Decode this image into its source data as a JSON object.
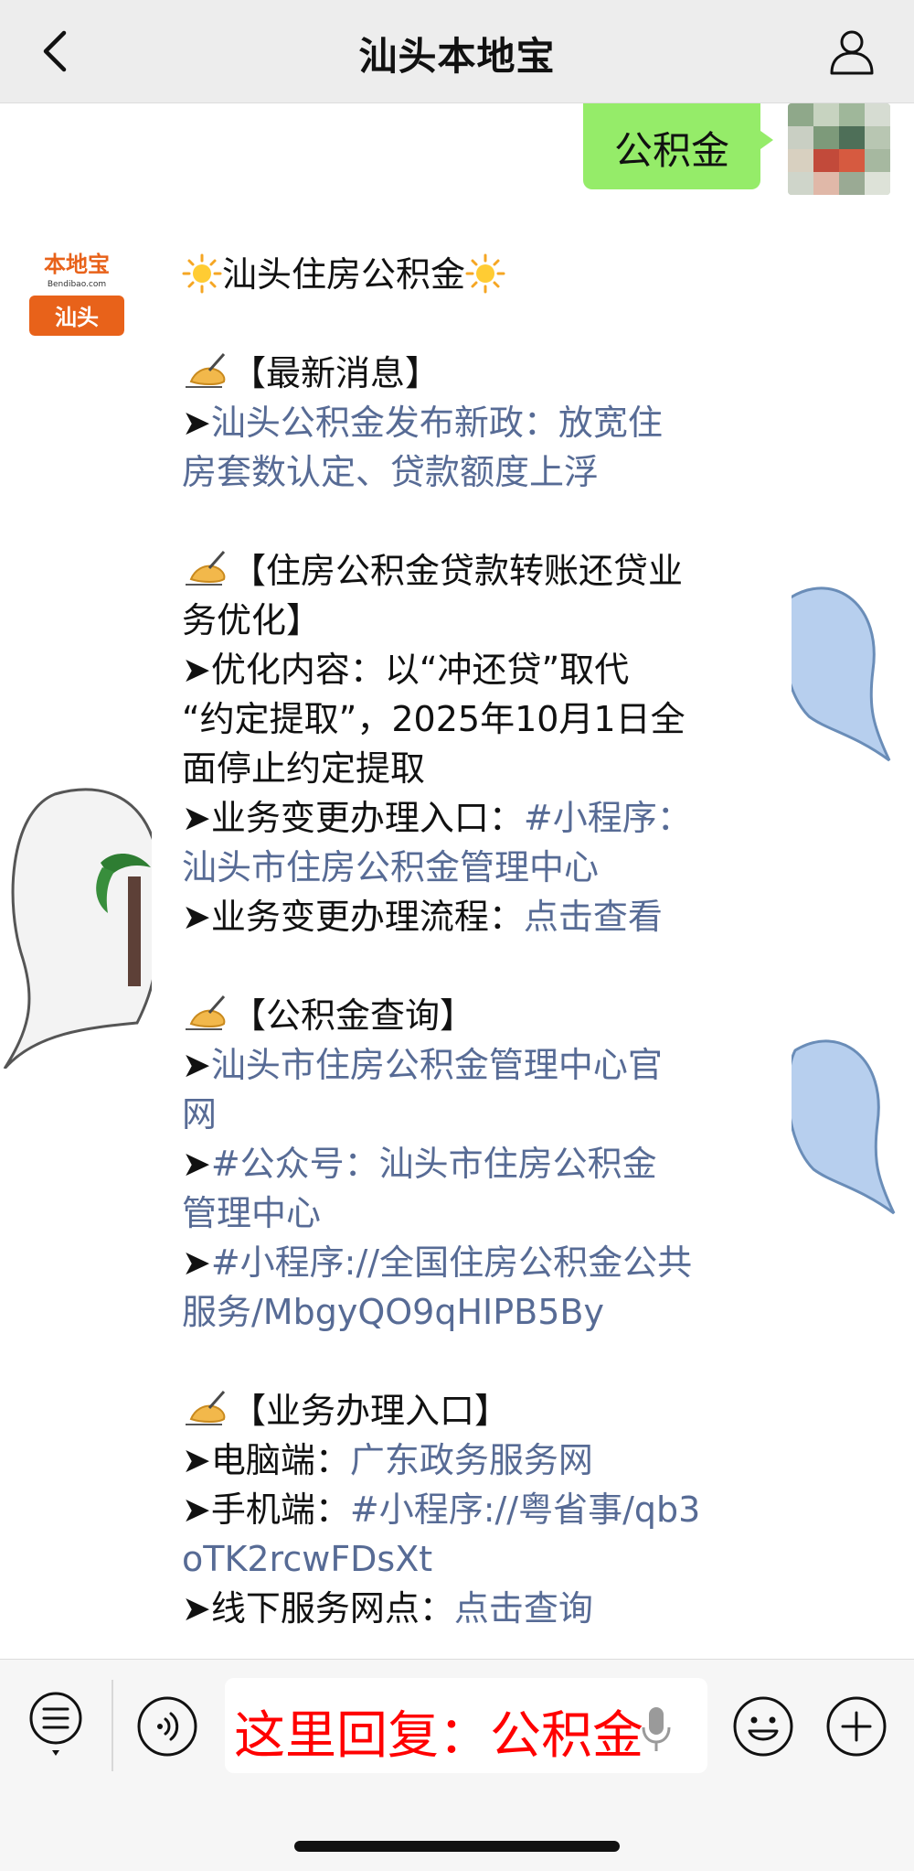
{
  "header": {
    "title": "汕头本地宝"
  },
  "chat": {
    "outgoing_text": "公积金",
    "bot_avatar": {
      "top_text": "本地宝",
      "sub_text": "Bendibao.com",
      "badge_text": "汕头"
    },
    "message": {
      "title": "汕头住房公积金",
      "s1_heading": "【最新消息】",
      "s1_item_link_l1": "汕头公积金发布新政：放宽住",
      "s1_item_link_l2": "房套数认定、贷款额度上浮",
      "s2_heading_l1": "【住房公积金贷款转账还贷业",
      "s2_heading_l2": "务优化】",
      "s2_item1_l1": "优化内容：以“冲还贷”取代",
      "s2_item1_l2": "“约定提取”，2025年10月1日全",
      "s2_item1_l3": "面停止约定提取",
      "s2_item2_label": "业务变更办理入口：",
      "s2_item2_link_l1": "#小程序：",
      "s2_item2_link_l2": "汕头市住房公积金管理中心",
      "s2_item3_label": "业务变更办理流程：",
      "s2_item3_link": "点击查看",
      "s3_heading": "【公积金查询】",
      "s3_item1_link_l1": "汕头市住房公积金管理中心官",
      "s3_item1_link_l2": "网",
      "s3_item2_link_l1": "#公众号：汕头市住房公积金",
      "s3_item2_link_l2": "管理中心",
      "s3_item3_link_l1": "#小程序://全国住房公积金公共",
      "s3_item3_link_l2": "服务/MbgyQO9qHIPB5By",
      "s4_heading": "【业务办理入口】",
      "s4_item1_label": "电脑端：",
      "s4_item1_link": "广东政务服务网",
      "s4_item2_label": "手机端：",
      "s4_item2_link_l1": "#小程序://粤省事/qb3",
      "s4_item2_link_l2": "oTK2rcwFDsXt",
      "s4_item3_label": "线下服务网点：",
      "s4_item3_link": "点击查询"
    }
  },
  "input": {
    "text": "这里回复：公积金"
  },
  "icons": {
    "back": "chevron-left-icon",
    "profile": "person-icon",
    "menu": "list-menu-icon",
    "voice": "voice-icon",
    "mic": "mic-icon",
    "emoji": "emoji-icon",
    "plus": "plus-icon",
    "sun": "sun-icon",
    "hand": "writing-hand-icon"
  },
  "colors": {
    "link": "#576b95",
    "bubble": "#95ec69",
    "input_text": "#ff0000",
    "brand": "#e8621a"
  }
}
